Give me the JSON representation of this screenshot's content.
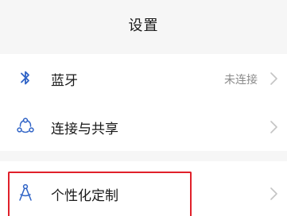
{
  "header": {
    "title": "设置"
  },
  "items": [
    {
      "label": "蓝牙",
      "status": "未连接",
      "icon": "bluetooth-icon"
    },
    {
      "label": "连接与共享",
      "status": "",
      "icon": "connection-share-icon"
    },
    {
      "label": "个性化定制",
      "status": "",
      "icon": "personalization-icon"
    }
  ],
  "colors": {
    "accent_icon": "#2f63c6",
    "highlight_border": "#e0202a",
    "chevron": "#c4c4c4"
  }
}
